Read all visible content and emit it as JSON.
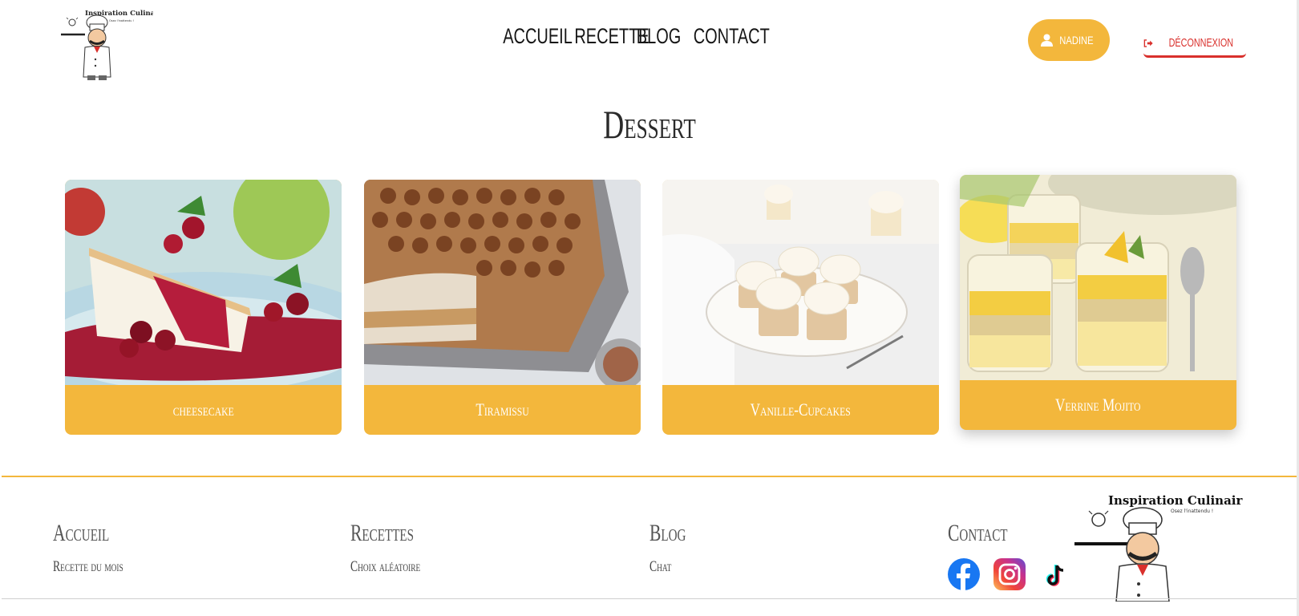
{
  "header": {
    "logo_text": "Inspiration Culinaire",
    "logo_tagline": "Osez l'inattendu !",
    "nav": [
      "ACCUEIL",
      "RECETTE",
      "BLOG",
      "CONTACT"
    ],
    "user_label": "NADINE",
    "logout_label": "DÉCONNEXION"
  },
  "main": {
    "title": "Dessert",
    "cards": [
      {
        "label": "cheesecake",
        "image_alt": "cheesecake"
      },
      {
        "label": "Tiramissu",
        "image_alt": "Tiramissu"
      },
      {
        "label": "Vanille-Cupcakes",
        "image_alt": "Vanille-Cupcakes"
      },
      {
        "label": "Verrine Mojito",
        "image_alt": "Verrine Mojito"
      }
    ]
  },
  "footer": {
    "columns": [
      {
        "heading": "Accueil",
        "link": "Recette du mois"
      },
      {
        "heading": "Recettes",
        "link": "Choix aléatoire"
      },
      {
        "heading": "Blog",
        "link": "Chat"
      },
      {
        "heading": "Contact"
      }
    ],
    "social": [
      "facebook-icon",
      "instagram-icon",
      "tiktok-icon"
    ],
    "logo_text": "Inspiration Culinaire",
    "logo_tagline": "Osez l'inattendu !"
  },
  "colors": {
    "accent": "#f3b73c",
    "logout": "#d9302c"
  }
}
